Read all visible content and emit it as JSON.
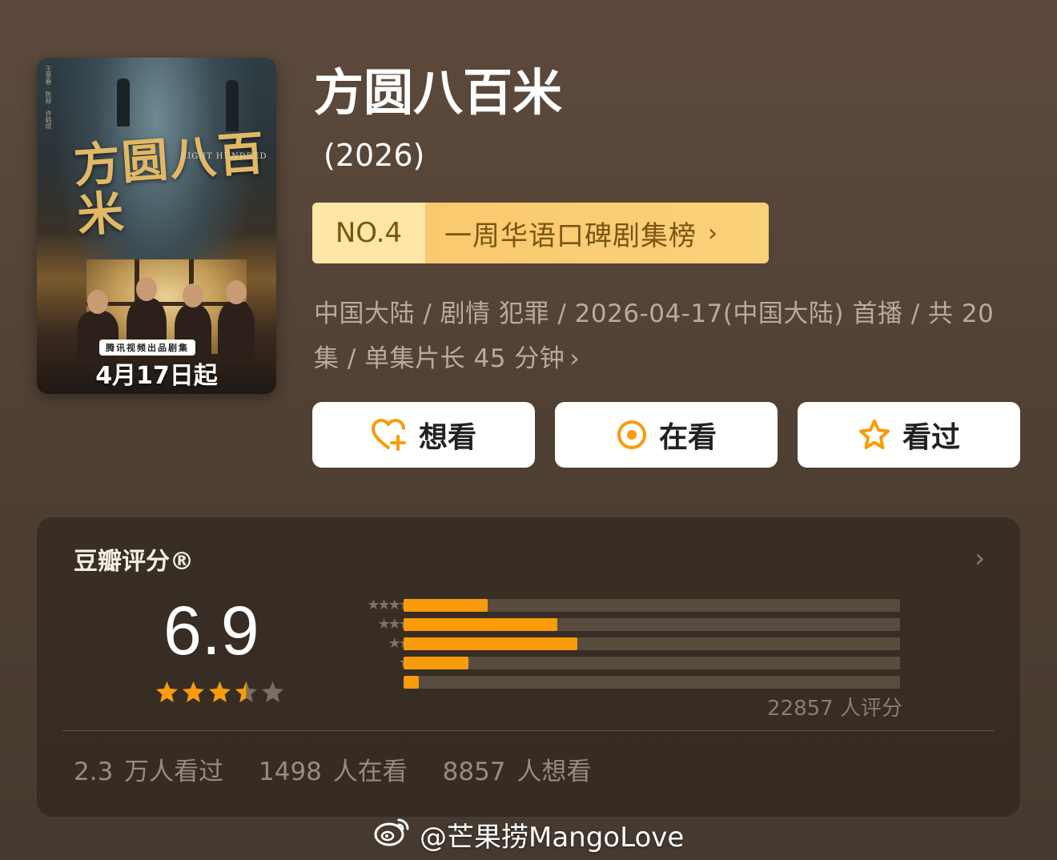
{
  "poster": {
    "title_art": "方圆八百米",
    "subtitle_art": "EIGHT HUNDRED",
    "badge": "腾讯视频出品剧集",
    "date": "4月17日起"
  },
  "title": "方圆八百米",
  "year": "(2026)",
  "rank": {
    "number": "NO.4",
    "list_label": "一周华语口碑剧集榜",
    "chevron": "›"
  },
  "meta": {
    "text": "中国大陆 / 剧情 犯罪 / 2026-04-17(中国大陆) 首播 / 共 20 集 / 单集片长 45 分钟",
    "chevron": "›"
  },
  "actions": {
    "want": "想看",
    "watching": "在看",
    "watched": "看过"
  },
  "rating": {
    "label": "豆瓣评分®",
    "score": "6.9",
    "score_stars": 3.5,
    "distribution": [
      {
        "stars": 5,
        "fraction": 0.17
      },
      {
        "stars": 4,
        "fraction": 0.31
      },
      {
        "stars": 3,
        "fraction": 0.35
      },
      {
        "stars": 2,
        "fraction": 0.13
      },
      {
        "stars": 1,
        "fraction": 0.03
      }
    ],
    "count": "22857 人评分",
    "stats": {
      "watched": "2.3 万人看过",
      "watching": "1498 人在看",
      "want": "8857 人想看"
    }
  },
  "watermark": "@芒果捞MangoLove",
  "colors": {
    "star": "#f99b0a",
    "bar": "#f99b0a",
    "rank_bg": "#f9c96e",
    "rank_text": "#7a5512"
  },
  "icons": [
    "heart-plus-icon",
    "target-icon",
    "star-outline-icon",
    "weibo-icon",
    "chevron-right-icon"
  ]
}
